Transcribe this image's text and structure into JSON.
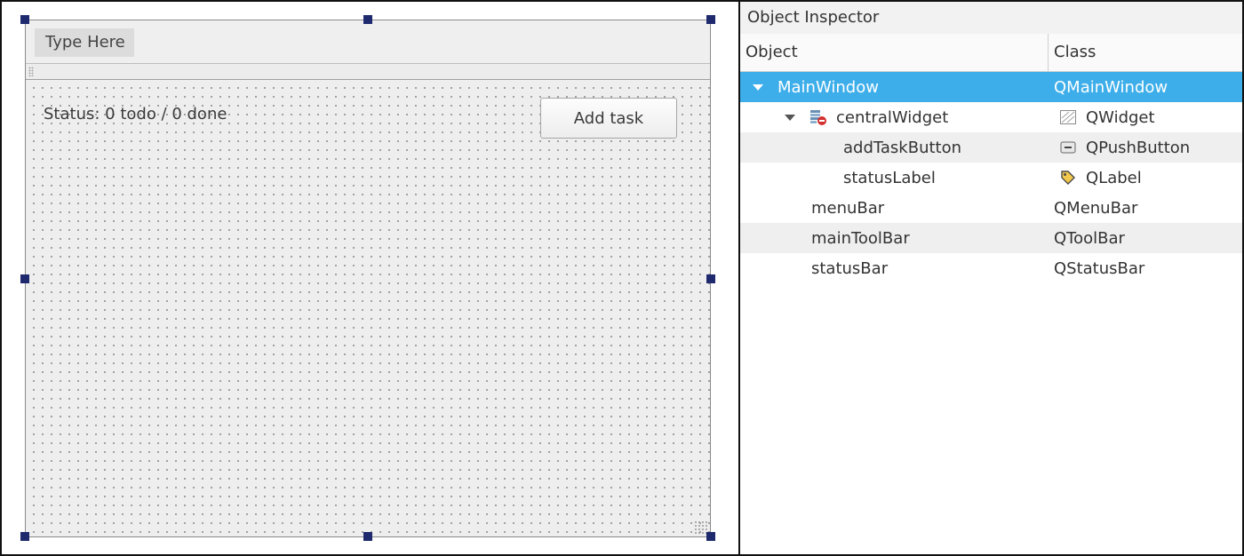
{
  "designer": {
    "menubar": {
      "placeholder_label": "Type Here"
    },
    "central_widget": {
      "status_label": "Status: 0 todo / 0 done",
      "add_task_button_label": "Add task"
    }
  },
  "inspector": {
    "title": "Object Inspector",
    "columns": {
      "object": "Object",
      "class": "Class"
    },
    "rows": [
      {
        "object": "MainWindow",
        "class": "QMainWindow",
        "expanded": true,
        "selected": true,
        "object_icon": "",
        "class_icon": ""
      },
      {
        "object": "centralWidget",
        "class": "QWidget",
        "expanded": true,
        "selected": false,
        "object_icon": "layout-broken-icon",
        "class_icon": "widget-icon"
      },
      {
        "object": "addTaskButton",
        "class": "QPushButton",
        "expanded": false,
        "selected": false,
        "object_icon": "",
        "class_icon": "pushbutton-icon"
      },
      {
        "object": "statusLabel",
        "class": "QLabel",
        "expanded": false,
        "selected": false,
        "object_icon": "",
        "class_icon": "label-tag-icon"
      },
      {
        "object": "menuBar",
        "class": "QMenuBar",
        "expanded": false,
        "selected": false,
        "object_icon": "",
        "class_icon": ""
      },
      {
        "object": "mainToolBar",
        "class": "QToolBar",
        "expanded": false,
        "selected": false,
        "object_icon": "",
        "class_icon": ""
      },
      {
        "object": "statusBar",
        "class": "QStatusBar",
        "expanded": false,
        "selected": false,
        "object_icon": "",
        "class_icon": ""
      }
    ]
  },
  "colors": {
    "selection": "#3daee9",
    "selection_handle": "#1f2a6e",
    "alternate_row": "#efefef",
    "form_background": "#eeeeee"
  }
}
